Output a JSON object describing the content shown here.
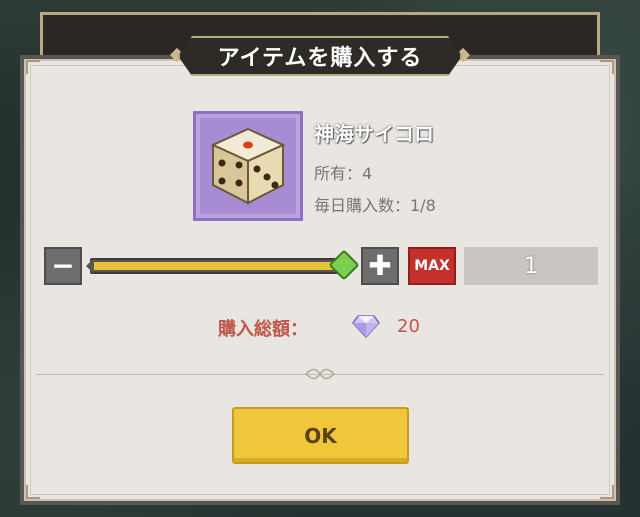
{
  "dialog": {
    "title": "アイテムを購入する"
  },
  "item": {
    "name": "神海サイコロ",
    "owned": "所有：4",
    "daily_purchases": "毎日購入数：1/8",
    "icon": "dice-icon"
  },
  "quantity": {
    "minus_label": "−",
    "plus_label": "✚",
    "max_label": "MAX",
    "value": "1",
    "slider_fraction": 1.0
  },
  "total": {
    "label": "購入総額：",
    "currency_icon": "diamond-gem-icon",
    "value": "20"
  },
  "actions": {
    "ok_label": "OK"
  },
  "colors": {
    "accent_yellow": "#f0c73b",
    "max_red": "#c4302b",
    "slider_knob": "#7bd04f",
    "item_frame": "#a78bd3",
    "total_text": "#c0574a"
  }
}
